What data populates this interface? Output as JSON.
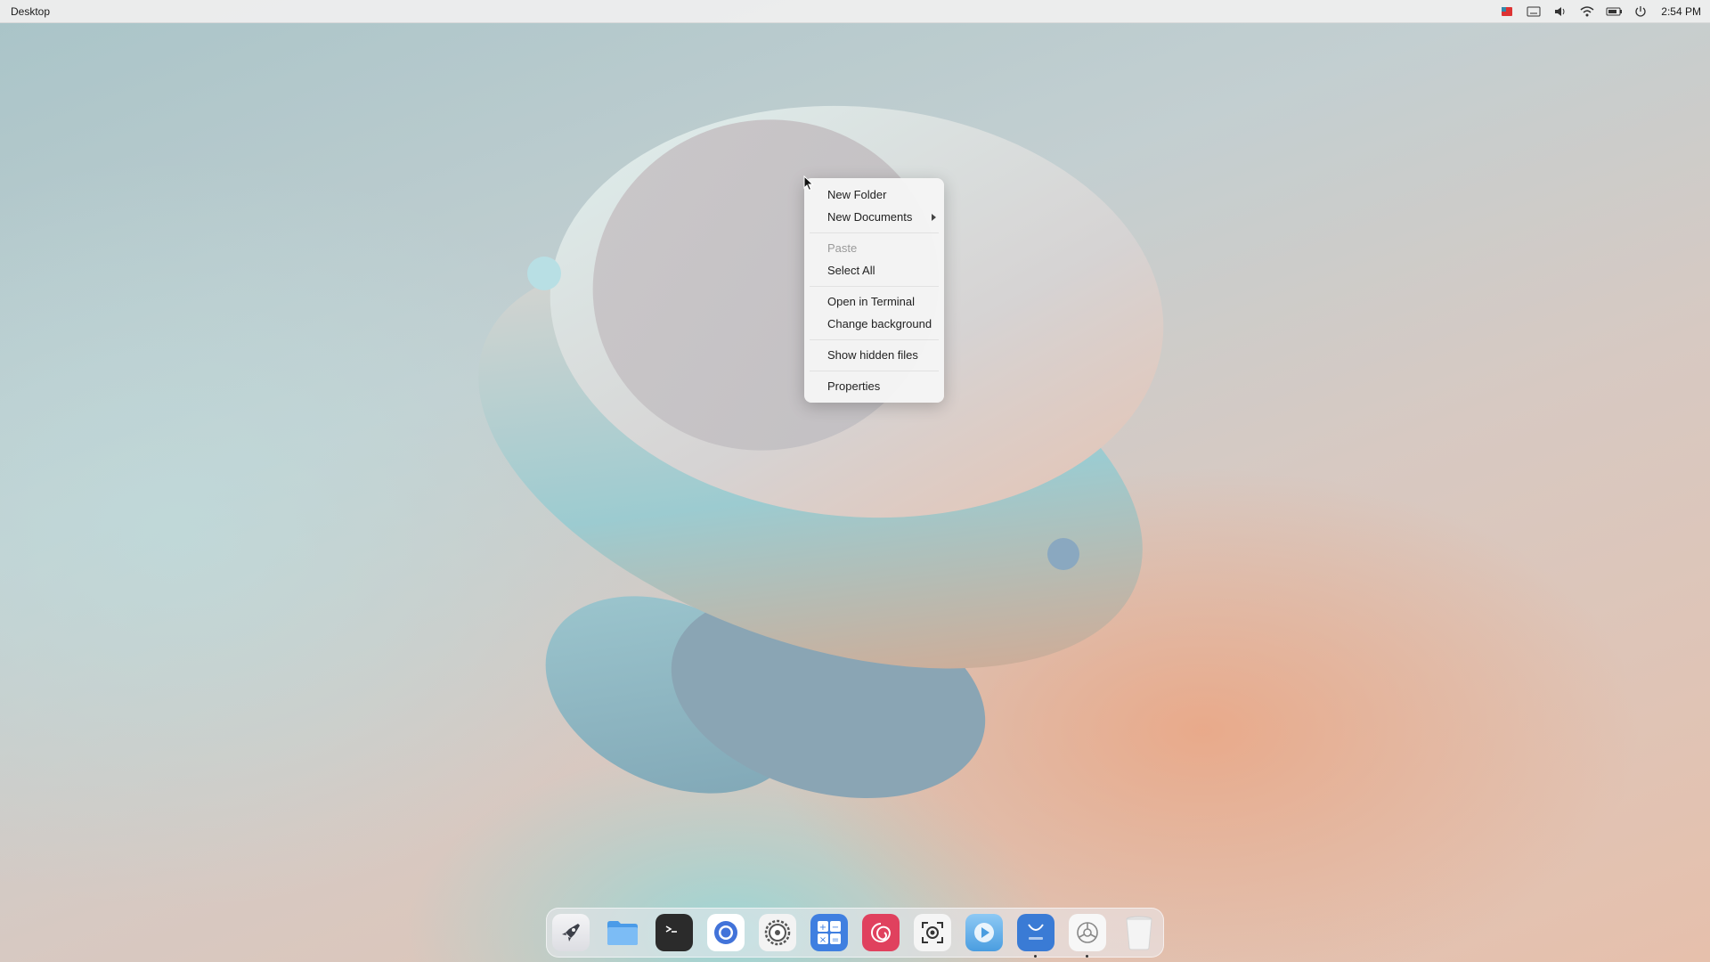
{
  "panel": {
    "title": "Desktop",
    "clock": "2:54 PM",
    "tray_icons": [
      "flag-icon",
      "keyboard-icon",
      "volume-icon",
      "wifi-icon",
      "battery-icon",
      "power-icon"
    ]
  },
  "context_menu": {
    "items": [
      {
        "label": "New Folder",
        "enabled": true
      },
      {
        "label": "New Documents",
        "enabled": true,
        "submenu": true
      },
      {
        "label": "Paste",
        "enabled": false
      },
      {
        "label": "Select All",
        "enabled": true
      },
      {
        "label": "Open in Terminal",
        "enabled": true
      },
      {
        "label": "Change background",
        "enabled": true
      },
      {
        "label": "Show hidden files",
        "enabled": true
      },
      {
        "label": "Properties",
        "enabled": true
      }
    ]
  },
  "dock": {
    "items": [
      {
        "name": "launcher",
        "icon": "rocket-icon"
      },
      {
        "name": "file-manager",
        "icon": "folder-icon"
      },
      {
        "name": "terminal",
        "icon": "terminal-icon"
      },
      {
        "name": "browser",
        "icon": "browser-icon"
      },
      {
        "name": "settings",
        "icon": "gear-icon"
      },
      {
        "name": "calculator",
        "icon": "calculator-icon"
      },
      {
        "name": "debian-app",
        "icon": "swirl-icon"
      },
      {
        "name": "screenshot",
        "icon": "camera-icon"
      },
      {
        "name": "media-player",
        "icon": "play-icon"
      },
      {
        "name": "app-store",
        "icon": "shopping-bag-icon",
        "running": true
      },
      {
        "name": "system-settings",
        "icon": "cog-icon",
        "running": true
      },
      {
        "name": "trash",
        "icon": "trash-icon"
      }
    ]
  },
  "colors": {
    "accent": "#3a7bd5",
    "menu_bg": "#f5f5f5",
    "disabled_text": "#9a9a9a"
  }
}
